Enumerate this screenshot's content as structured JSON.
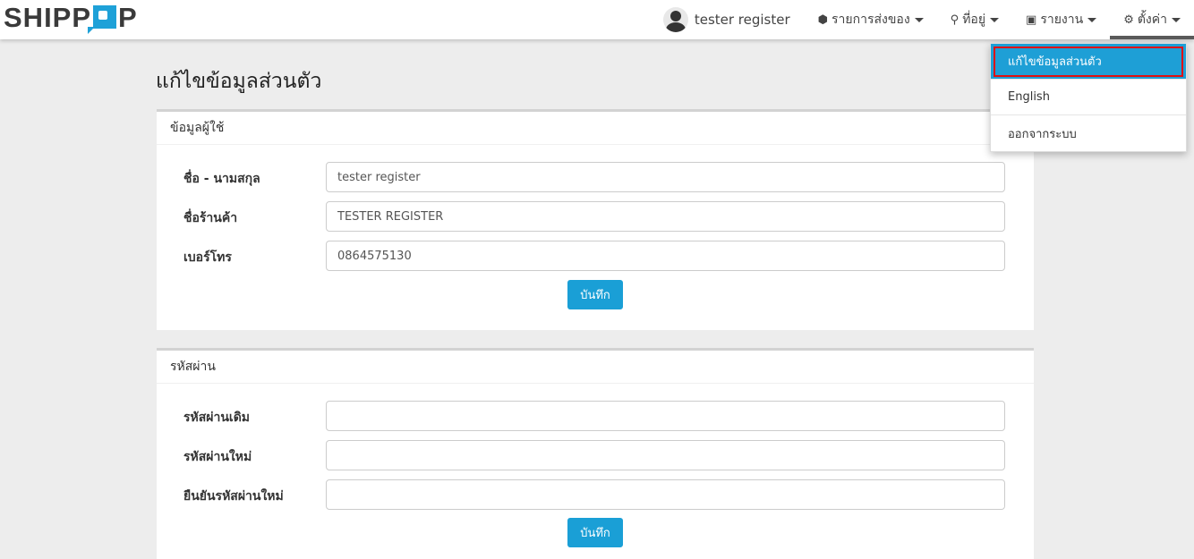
{
  "brand": {
    "left": "SHIPP",
    "right": "P"
  },
  "nav": {
    "user_name": "tester register",
    "items": [
      {
        "icon": "box-icon",
        "glyph": "⬢",
        "label": "รายการส่งของ"
      },
      {
        "icon": "map-marker-icon",
        "glyph": "⚲",
        "label": "ที่อยู่"
      },
      {
        "icon": "file-pdf-icon",
        "glyph": "▣",
        "label": "รายงาน"
      },
      {
        "icon": "gear-icon",
        "glyph": "⚙",
        "label": "ตั้งค่า"
      }
    ]
  },
  "dropdown": {
    "items": [
      "แก้ไขข้อมูลส่วนตัว",
      "English",
      "ออกจากระบบ"
    ]
  },
  "page_title": "แก้ไขข้อมูลส่วนตัว",
  "user_panel": {
    "heading": "ข้อมูลผู้ใช้",
    "fields": [
      {
        "label": "ชื่อ - นามสกุล",
        "value": "tester register"
      },
      {
        "label": "ชื่อร้านค้า",
        "value": "TESTER REGISTER"
      },
      {
        "label": "เบอร์โทร",
        "value": "0864575130"
      }
    ],
    "save_label": "บันทึก"
  },
  "password_panel": {
    "heading": "รหัสผ่าน",
    "fields": [
      {
        "label": "รหัสผ่านเดิม",
        "value": ""
      },
      {
        "label": "รหัสผ่านใหม่",
        "value": ""
      },
      {
        "label": "ยืนยันรหัสผ่านใหม่",
        "value": ""
      }
    ],
    "save_label": "บันทึก"
  },
  "colors": {
    "accent": "#1a9fd6",
    "highlight_border": "#e01010"
  }
}
